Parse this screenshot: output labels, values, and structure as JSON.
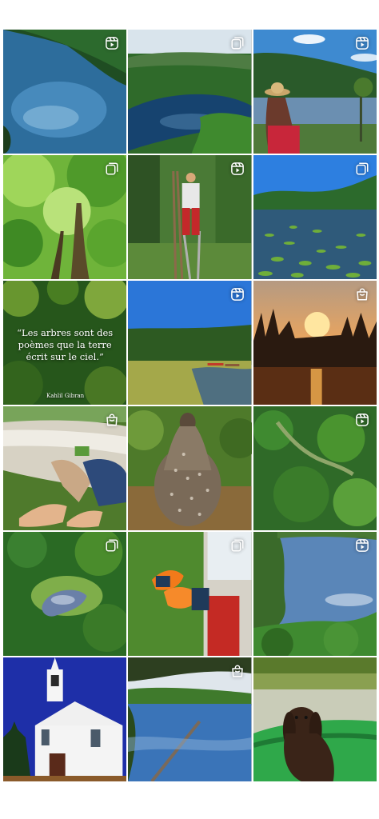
{
  "grid": {
    "posts": [
      {
        "name": "lake-aerial-forest",
        "type": "reel",
        "icon": "reel-icon"
      },
      {
        "name": "lake-valley-view",
        "type": "carousel",
        "icon": "carousel-icon"
      },
      {
        "name": "woman-hat-lake",
        "type": "reel",
        "icon": "reel-icon"
      },
      {
        "name": "forest-canopy",
        "type": "carousel",
        "icon": "carousel-icon"
      },
      {
        "name": "man-ladder-forest",
        "type": "reel",
        "icon": "reel-icon"
      },
      {
        "name": "lily-pad-lake",
        "type": "carousel",
        "icon": "carousel-icon"
      },
      {
        "name": "quote-leaves",
        "type": "image",
        "icon": ""
      },
      {
        "name": "marsh-dock",
        "type": "reel",
        "icon": "reel-icon"
      },
      {
        "name": "sunset-lake",
        "type": "shop",
        "icon": "shopping-bag-icon"
      },
      {
        "name": "canoe-feet",
        "type": "shop",
        "icon": "shopping-bag-icon"
      },
      {
        "name": "grouse-bird",
        "type": "image",
        "icon": ""
      },
      {
        "name": "aerial-green-hills",
        "type": "reel",
        "icon": "reel-icon"
      },
      {
        "name": "aerial-forest-pond",
        "type": "carousel",
        "icon": "carousel-icon"
      },
      {
        "name": "mushrooms-hands",
        "type": "carousel",
        "icon": "carousel-icon"
      },
      {
        "name": "lake-cliffs",
        "type": "reel",
        "icon": "reel-icon"
      },
      {
        "name": "white-church",
        "type": "image",
        "icon": ""
      },
      {
        "name": "calm-lake-log",
        "type": "shop",
        "icon": "shopping-bag-icon"
      },
      {
        "name": "dog-canoe",
        "type": "image",
        "icon": ""
      }
    ],
    "quote": {
      "text": "“Les arbres sont des poèmes que la terre écrit sur le ciel.”",
      "author": "Kahlil Gibran"
    }
  }
}
